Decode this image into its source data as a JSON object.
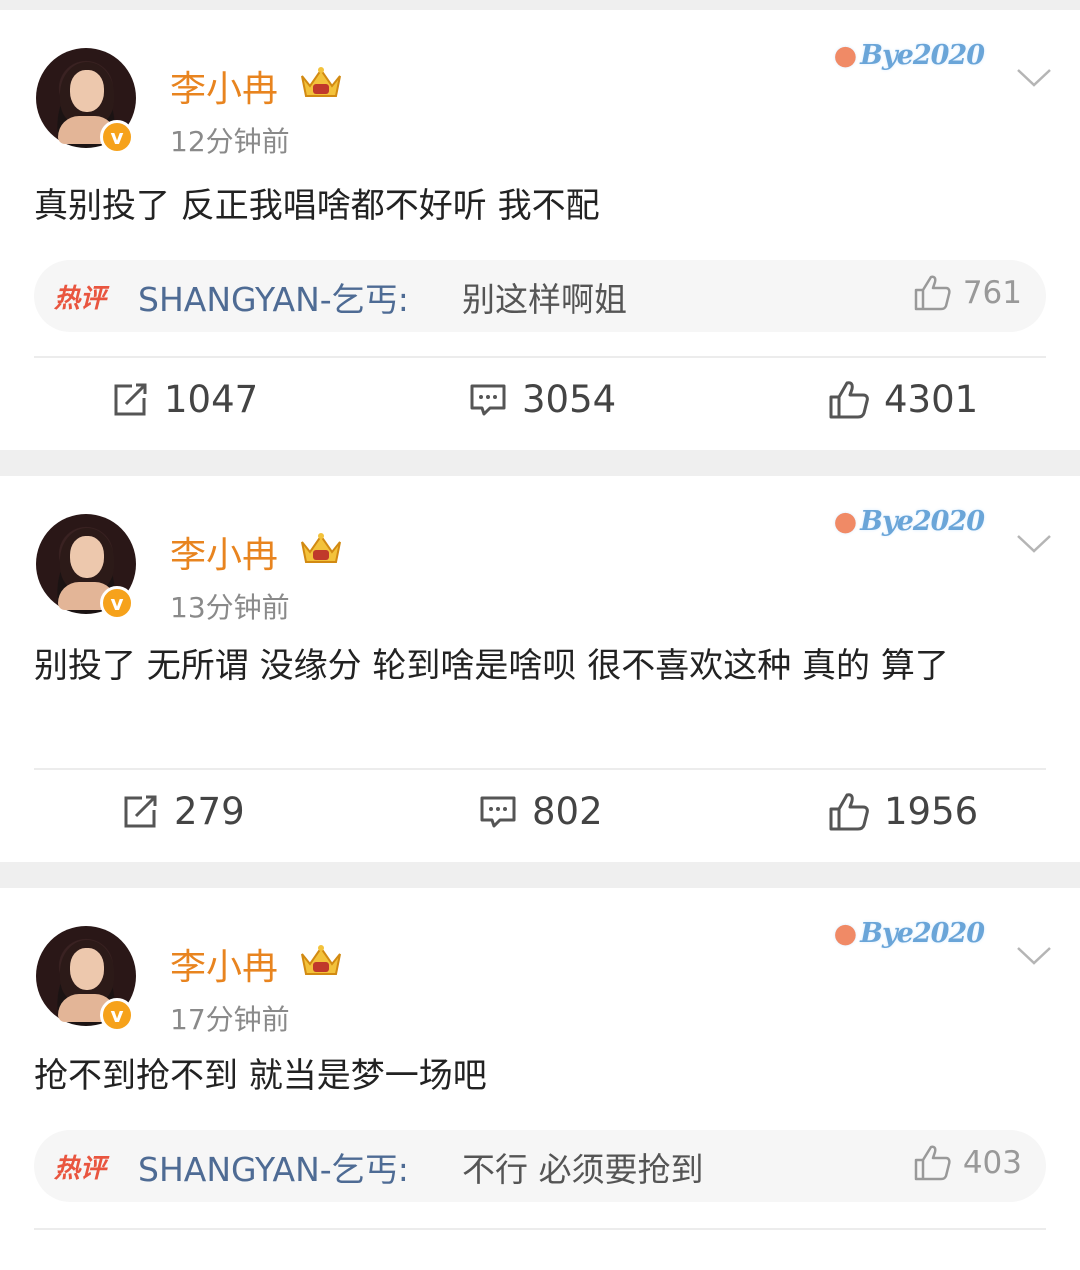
{
  "posts": [
    {
      "username": "李小冉",
      "time": "12分钟前",
      "watermark": "Bye2020",
      "content": "真别投了 反正我唱啥都不好听 我不配",
      "hot_comment": {
        "label": "热评",
        "user": "SHANGYAN-乞丐:",
        "text": "别这样啊姐",
        "likes": "761"
      },
      "reposts": "1047",
      "comments": "3054",
      "likes": "4301"
    },
    {
      "username": "李小冉",
      "time": "13分钟前",
      "watermark": "Bye2020",
      "content": "别投了 无所谓 没缘分 轮到啥是啥呗 很不喜欢这种 真的  算了",
      "reposts": "279",
      "comments": "802",
      "likes": "1956"
    },
    {
      "username": "李小冉",
      "time": "17分钟前",
      "watermark": "Bye2020",
      "content": "抢不到抢不到 就当是梦一场吧",
      "hot_comment": {
        "label": "热评",
        "user": "SHANGYAN-乞丐:",
        "text": "不行 必须要抢到",
        "likes": "403"
      }
    }
  ],
  "colors": {
    "username": "#e8841f",
    "verified": "#f6a21b",
    "hot_label": "#e9553f",
    "link_user": "#4e6b94"
  },
  "icons": [
    "crown-badge-icon",
    "chevron-down-icon",
    "repost-icon",
    "comment-icon",
    "like-icon"
  ]
}
